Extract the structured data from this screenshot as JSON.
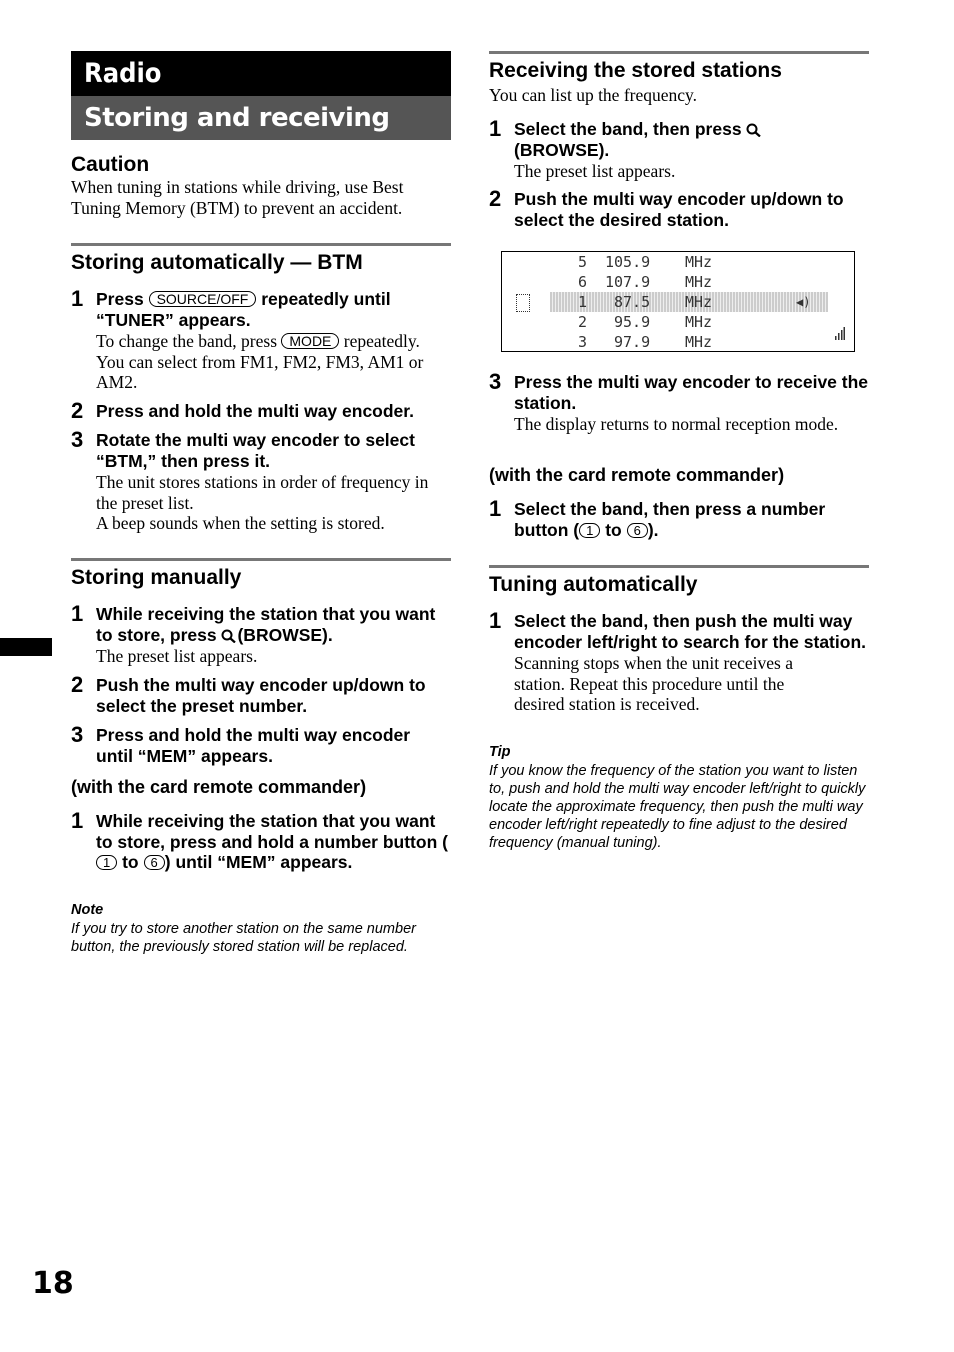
{
  "title": "Radio",
  "subtitle": "Storing and receiving stations",
  "caution": {
    "heading": "Caution",
    "text": "When tuning in stations while driving, use Best Tuning Memory (BTM) to prevent an accident."
  },
  "btm": {
    "heading": "Storing automatically — BTM",
    "s1": {
      "num": "1",
      "a": "Press",
      "btn": "SOURCE/OFF",
      "b": "repeatedly until “TUNER” appears.",
      "body_a": "To change the band, press",
      "body_btn": "MODE",
      "body_b": "repeatedly. You can select from FM1, FM2, FM3, AM1 or AM2."
    },
    "s2": {
      "num": "2",
      "text": "Press and hold the multi way encoder."
    },
    "s3": {
      "num": "3",
      "text": "Rotate the multi way encoder to select “BTM,” then press it.",
      "body1": "The unit stores stations in order of frequency in the preset list.",
      "body2": "A beep sounds when the setting is stored."
    }
  },
  "manual": {
    "heading": "Storing manually",
    "s1": {
      "num": "1",
      "a": "While receiving the station that you want to store, press",
      "b": "(BROWSE).",
      "body": "The preset list appears."
    },
    "s2": {
      "num": "2",
      "text": "Push the multi way encoder up/down to select the preset number."
    },
    "s3": {
      "num": "3",
      "text": "Press and hold the multi way encoder until “MEM” appears."
    },
    "remote": "(with the card remote commander)",
    "r1": {
      "num": "1",
      "a": "While receiving the station that you want to store, press and hold a number button (",
      "n1": "1",
      "to": "to",
      "n2": "6",
      "b": ") until “MEM” appears."
    },
    "note_h": "Note",
    "note": "If you try to store another station on the same number button, the previously stored station will be replaced."
  },
  "receive": {
    "heading": "Receiving the stored stations",
    "intro": "You can list up the frequency.",
    "s1": {
      "num": "1",
      "a": "Select the band, then press",
      "b": "(BROWSE).",
      "body": "The preset list appears."
    },
    "s2": {
      "num": "2",
      "text": "Push the multi way encoder up/down to select the desired station."
    },
    "display": [
      {
        "preset": "5",
        "freq": "105.9",
        "unit": "MHz"
      },
      {
        "preset": "6",
        "freq": "107.9",
        "unit": "MHz"
      },
      {
        "preset": "1",
        "freq": "87.5",
        "unit": "MHz"
      },
      {
        "preset": "2",
        "freq": "95.9",
        "unit": "MHz"
      },
      {
        "preset": "3",
        "freq": "97.9",
        "unit": "MHz"
      }
    ],
    "s3": {
      "num": "3",
      "text": "Press the multi way encoder to receive the station.",
      "body": "The display returns to normal reception mode."
    },
    "remote": "(with the card remote commander)",
    "r1": {
      "num": "1",
      "a": "Select the band, then press a number button (",
      "n1": "1",
      "to": "to",
      "n2": "6",
      "b": ")."
    }
  },
  "tuning": {
    "heading": "Tuning automatically",
    "s1": {
      "num": "1",
      "text": "Select the band, then push the multi way encoder left/right to search for the station.",
      "body": "Scanning stops when the unit receives a station. Repeat this procedure until the desired station is received."
    },
    "tip_h": "Tip",
    "tip": "If you know the frequency of the station you want to listen to, push and hold the multi way encoder left/right to quickly locate the approximate frequency, then push the multi way encoder left/right repeatedly to fine adjust to the desired frequency (manual tuning)."
  },
  "page_number": "18"
}
